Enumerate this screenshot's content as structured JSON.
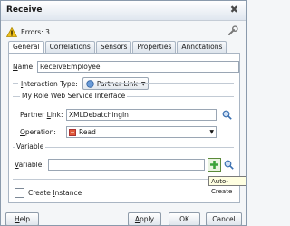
{
  "window": {
    "title": "Receive"
  },
  "status": {
    "errors_text": "Errors: 3"
  },
  "tabs": [
    {
      "label": "General"
    },
    {
      "label": "Correlations"
    },
    {
      "label": "Sensors"
    },
    {
      "label": "Properties"
    },
    {
      "label": "Annotations"
    }
  ],
  "form": {
    "name_label_key": "N",
    "name_label_rest": "ame:",
    "name_value": "ReceiveEmployee",
    "interaction_label_key": "I",
    "interaction_label_rest": "nteraction Type:",
    "interaction_value": "Partner Link",
    "group_title": "My Role Web Service Interface",
    "partner_link_label_pre": "Partner ",
    "partner_link_label_key": "L",
    "partner_link_label_rest": "ink:",
    "partner_link_value": "XMLDebatchingIn",
    "operation_label_pre": "",
    "operation_label_key": "O",
    "operation_label_rest": "peration:",
    "operation_value": "Read",
    "variable_section": "Variable",
    "variable_label_key": "V",
    "variable_label_rest": "ariable:",
    "variable_value": "",
    "create_instance_label_pre": "Create ",
    "create_instance_label_key": "I",
    "create_instance_label_rest": "nstance"
  },
  "tooltip": {
    "text": "Auto-Create"
  },
  "footer": {
    "help_key": "H",
    "help_rest": "elp",
    "apply_key": "A",
    "apply_rest": "pply",
    "ok_label": "OK",
    "cancel_label": "Cancel"
  },
  "colors": {
    "warning": "#f2c21b",
    "add_green": "#3aa33a",
    "search_blue": "#3a6fb0"
  }
}
